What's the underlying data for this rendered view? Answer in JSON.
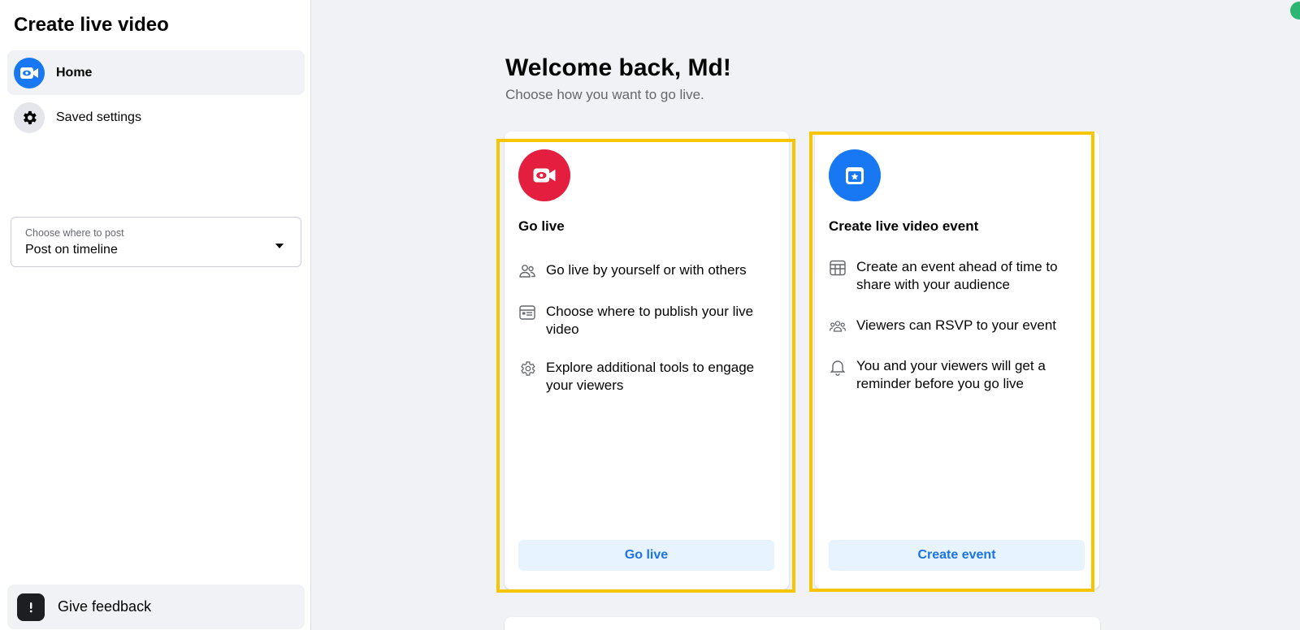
{
  "sidebar": {
    "title": "Create live video",
    "items": [
      {
        "label": "Home",
        "icon": "live-video-icon",
        "active": true
      },
      {
        "label": "Saved settings",
        "icon": "gear-icon",
        "active": false
      }
    ],
    "post_select": {
      "label": "Choose where to post",
      "value": "Post on timeline"
    },
    "feedback_label": "Give feedback"
  },
  "main": {
    "title": "Welcome back, Md!",
    "subtitle": "Choose how you want to go live."
  },
  "cards": [
    {
      "title": "Go live",
      "icon": "live-video-icon",
      "features": [
        {
          "icon": "people-icon",
          "text": "Go live by yourself or with others"
        },
        {
          "icon": "browser-window-icon",
          "text": "Choose where to publish your live video"
        },
        {
          "icon": "gear-icon",
          "text": "Explore additional tools to engage your viewers"
        }
      ],
      "button": "Go live"
    },
    {
      "title": "Create live video event",
      "icon": "calendar-star-icon",
      "features": [
        {
          "icon": "calendar-grid-icon",
          "text": "Create an event ahead of time to share with your audience"
        },
        {
          "icon": "group-icon",
          "text": "Viewers can RSVP to your event"
        },
        {
          "icon": "bell-icon",
          "text": "You and your viewers will get a reminder before you go live"
        }
      ],
      "button": "Create event"
    }
  ],
  "colors": {
    "accent": "#1877f2",
    "live_red": "#e41e3f",
    "highlight": "#f7c600",
    "button_bg": "#e7f3ff",
    "button_text": "#1b74e4"
  }
}
